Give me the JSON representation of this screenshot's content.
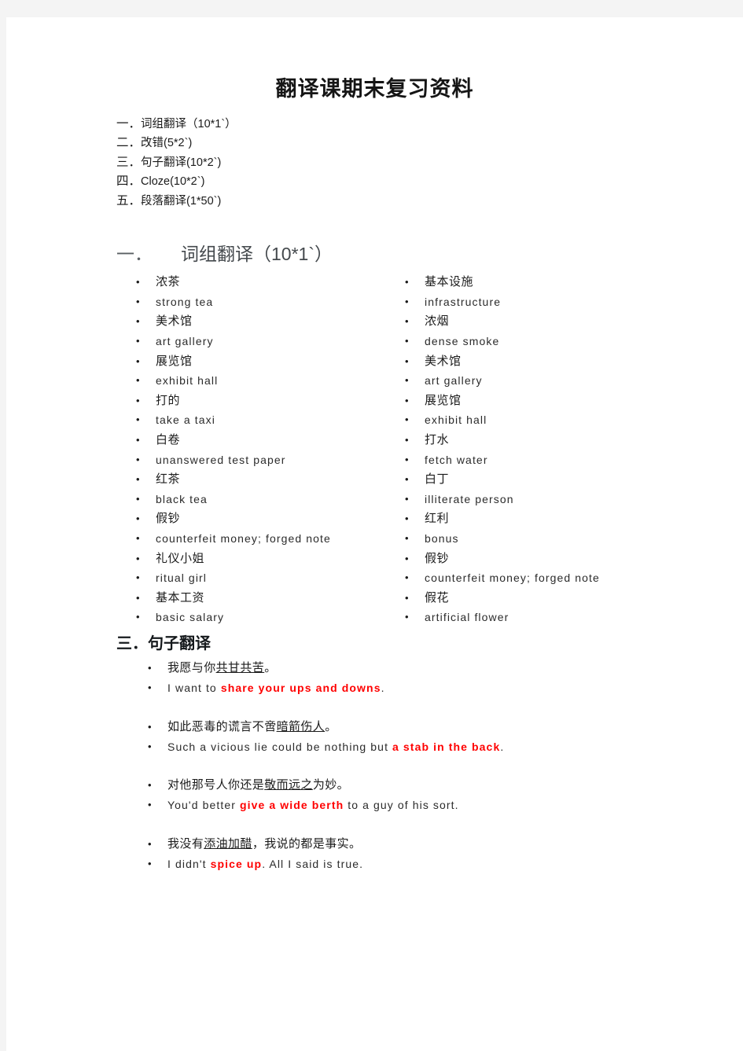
{
  "document": {
    "title": "翻译课期末复习资料",
    "toc": [
      {
        "num": "一．",
        "text": "词组翻译（10*1`）"
      },
      {
        "num": "二．",
        "text": "改错(5*2`)"
      },
      {
        "num": "三．",
        "text": "句子翻译(10*2`)"
      },
      {
        "num": "四．",
        "text": "Cloze(10*2`)"
      },
      {
        "num": "五．",
        "text": "段落翻译(1*50`)"
      }
    ],
    "bullet_glyph": "•",
    "section_one": {
      "num": "一．",
      "heading": "词组翻译（10*1`）",
      "left_column": [
        {
          "type": "cn",
          "text": "浓茶"
        },
        {
          "type": "en",
          "text": "strong tea"
        },
        {
          "type": "cn",
          "text": "美术馆"
        },
        {
          "type": "en",
          "text": "art gallery"
        },
        {
          "type": "cn",
          "text": "展览馆"
        },
        {
          "type": "en",
          "text": "exhibit hall"
        },
        {
          "type": "cn",
          "text": "打的"
        },
        {
          "type": "en",
          "text": "take a taxi"
        },
        {
          "type": "cn",
          "text": "白卷"
        },
        {
          "type": "en",
          "text": "unanswered test paper"
        },
        {
          "type": "cn",
          "text": "红茶"
        },
        {
          "type": "en",
          "text": "black tea"
        },
        {
          "type": "cn",
          "text": "假钞"
        },
        {
          "type": "en",
          "text": "counterfeit money; forged note"
        },
        {
          "type": "cn",
          "text": "礼仪小姐"
        },
        {
          "type": "en",
          "text": "ritual girl"
        },
        {
          "type": "cn",
          "text": "基本工资"
        },
        {
          "type": "en",
          "text": "basic salary"
        }
      ],
      "right_column": [
        {
          "type": "cn",
          "text": "基本设施"
        },
        {
          "type": "en",
          "text": "infrastructure"
        },
        {
          "type": "cn",
          "text": "浓烟"
        },
        {
          "type": "en",
          "text": "dense smoke"
        },
        {
          "type": "cn",
          "text": "美术馆"
        },
        {
          "type": "en",
          "text": "art gallery"
        },
        {
          "type": "cn",
          "text": "展览馆"
        },
        {
          "type": "en",
          "text": "exhibit hall"
        },
        {
          "type": "cn",
          "text": "打水"
        },
        {
          "type": "en",
          "text": "fetch water"
        },
        {
          "type": "cn",
          "text": "白丁"
        },
        {
          "type": "en",
          "text": "illiterate person"
        },
        {
          "type": "cn",
          "text": "红利"
        },
        {
          "type": "en",
          "text": "bonus"
        },
        {
          "type": "cn",
          "text": "假钞"
        },
        {
          "type": "en",
          "text": "counterfeit money; forged note"
        },
        {
          "type": "cn",
          "text": "假花"
        },
        {
          "type": "en",
          "text": "artificial flower"
        }
      ]
    },
    "section_three": {
      "heading": "三．句子翻译",
      "pairs": [
        {
          "cn_pre": "我愿与你",
          "cn_underline": "共甘共苦",
          "cn_post": "。",
          "en_pre": "I want to ",
          "en_hl": "share your ups and downs",
          "en_post": "."
        },
        {
          "cn_pre": "如此恶毒的谎言不啻",
          "cn_underline": "暗箭伤人",
          "cn_post": "。",
          "en_pre": "Such a vicious lie could be nothing but ",
          "en_hl": "a stab in the back",
          "en_post": "."
        },
        {
          "cn_pre": "对他那号人你还是",
          "cn_underline": "敬而远之",
          "cn_post": "为妙。",
          "en_pre": "You'd better ",
          "en_hl": "give a wide berth",
          "en_post": " to a guy of his sort."
        },
        {
          "cn_pre": "我没有",
          "cn_underline": "添油加醋",
          "cn_post": "，我说的都是事实。",
          "en_pre": "I didn't ",
          "en_hl": "spice up",
          "en_post": ". All I said is true."
        }
      ]
    },
    "colors": {
      "highlight": "#ff0000",
      "page_background": "#ffffff",
      "canvas_background": "#f4f4f4",
      "heading_one": "#44494d",
      "body_text": "#1c1c1c"
    }
  }
}
